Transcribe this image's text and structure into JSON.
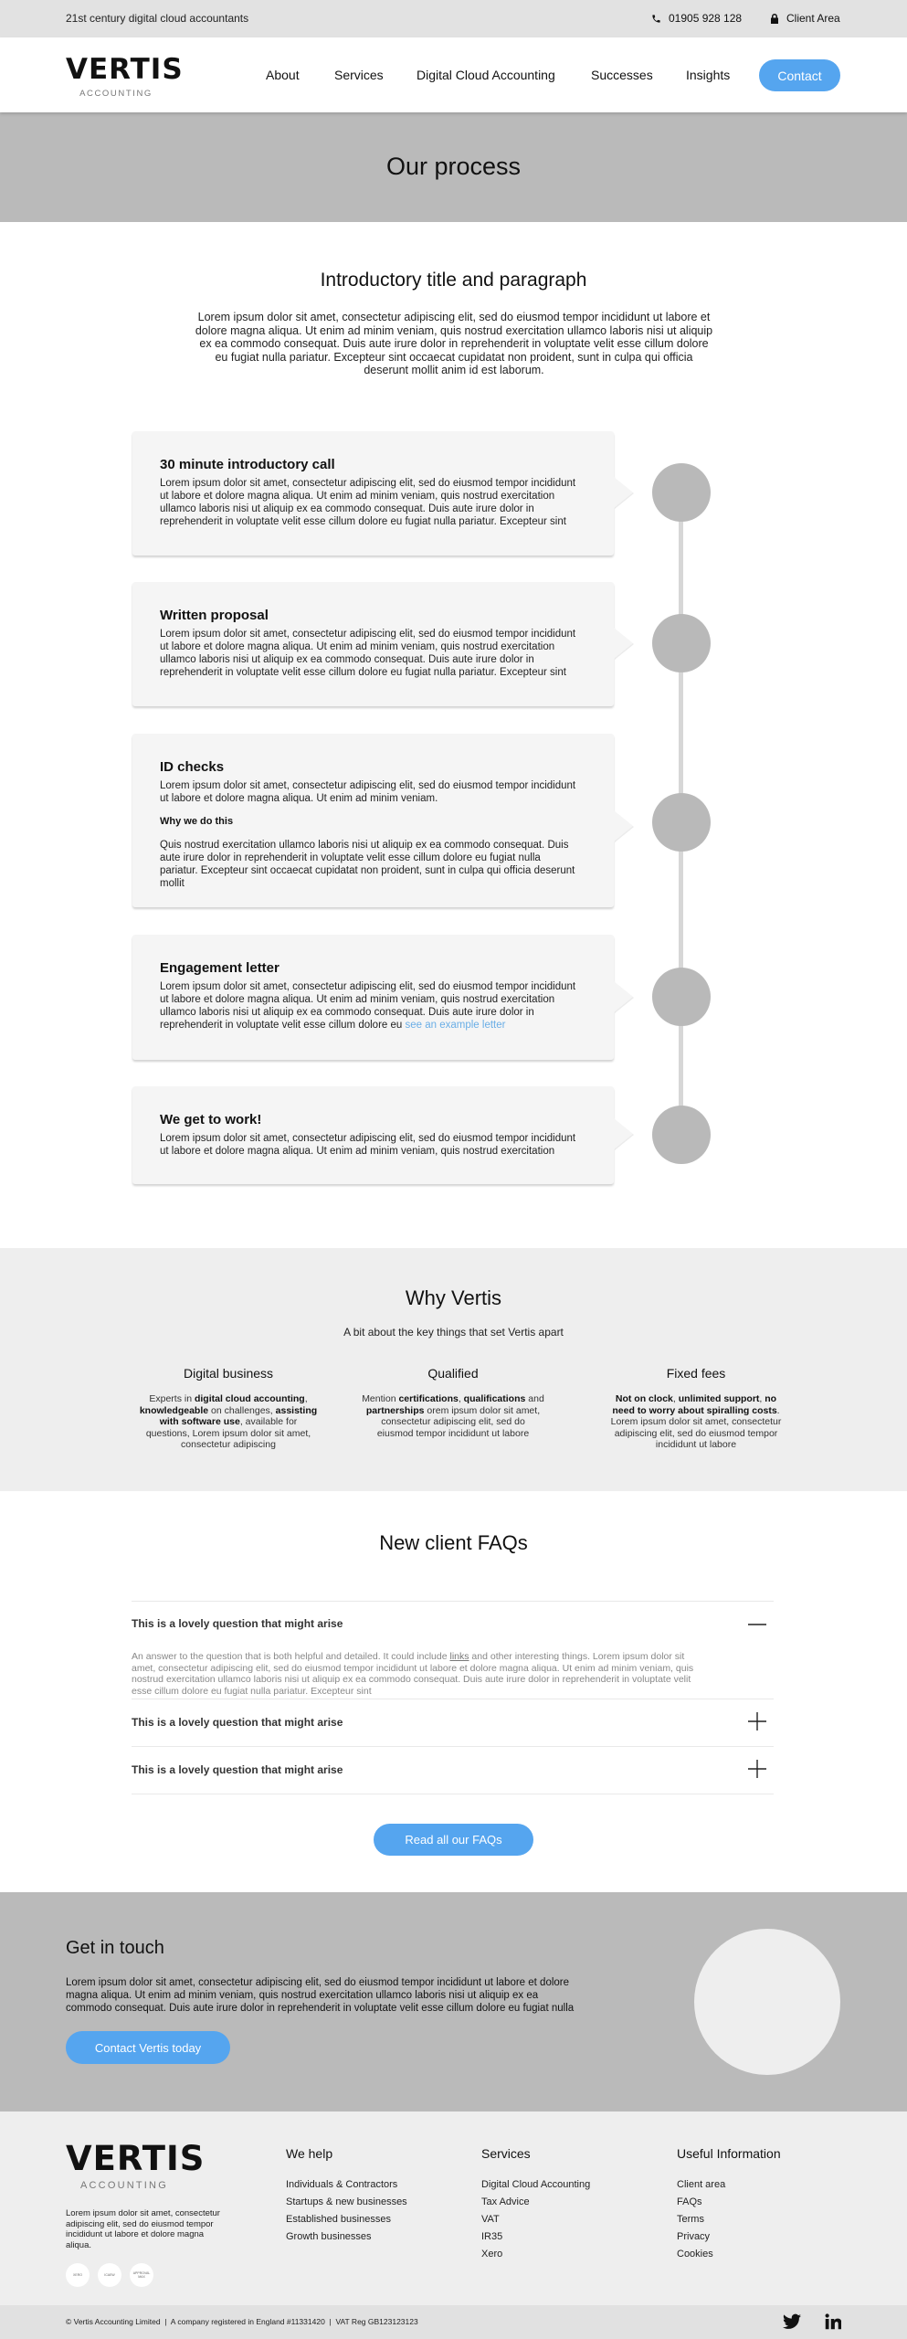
{
  "topbar": {
    "tagline": "21st century digital cloud accountants",
    "phone": "01905 928 128",
    "client_area": "Client Area"
  },
  "brand": {
    "name": "VERTIS",
    "subtitle": "ACCOUNTING"
  },
  "nav": {
    "items": [
      "About",
      "Services",
      "Digital Cloud Accounting",
      "Successes",
      "Insights"
    ],
    "cta": "Contact"
  },
  "hero": {
    "title": "Our process"
  },
  "intro": {
    "title": "Introductory title and paragraph",
    "text": "Lorem ipsum dolor sit amet, consectetur adipiscing elit, sed do eiusmod tempor incididunt ut labore et dolore magna aliqua. Ut enim ad minim veniam, quis nostrud exercitation ullamco laboris nisi ut aliquip ex ea commodo consequat. Duis aute irure dolor in reprehenderit in voluptate velit esse cillum dolore eu fugiat nulla pariatur. Excepteur sint occaecat cupidatat non proident, sunt in culpa qui officia deserunt mollit anim id est laborum."
  },
  "steps": [
    {
      "title": "30 minute introductory call",
      "text": "Lorem ipsum dolor sit amet, consectetur adipiscing elit, sed do eiusmod tempor incididunt ut labore et dolore magna aliqua. Ut enim ad minim veniam, quis nostrud exercitation ullamco laboris nisi ut aliquip ex ea commodo consequat. Duis aute irure dolor in reprehenderit in voluptate velit esse cillum dolore eu fugiat nulla pariatur. Excepteur sint"
    },
    {
      "title": "Written proposal",
      "text": "Lorem ipsum dolor sit amet, consectetur adipiscing elit, sed do eiusmod tempor incididunt ut labore et dolore magna aliqua. Ut enim ad minim veniam, quis nostrud exercitation ullamco laboris nisi ut aliquip ex ea commodo consequat. Duis aute irure dolor in reprehenderit in voluptate velit esse cillum dolore eu fugiat nulla pariatur. Excepteur sint"
    },
    {
      "title": "ID checks",
      "text": "Lorem ipsum dolor sit amet, consectetur adipiscing elit, sed do eiusmod tempor incididunt ut labore et dolore magna aliqua. Ut enim ad minim veniam.",
      "subheading": "Why we do this",
      "subtext": "Quis nostrud exercitation ullamco laboris nisi ut aliquip ex ea commodo consequat. Duis aute irure dolor in reprehenderit in voluptate velit esse cillum dolore eu fugiat nulla pariatur. Excepteur sint occaecat cupidatat non proident, sunt in culpa qui officia deserunt mollit"
    },
    {
      "title": "Engagement letter",
      "text": "Lorem ipsum dolor sit amet, consectetur adipiscing elit, sed do eiusmod tempor incididunt ut labore et dolore magna aliqua. Ut enim ad minim veniam, quis nostrud exercitation ullamco laboris nisi ut aliquip ex ea commodo consequat. Duis aute irure dolor in reprehenderit in voluptate velit esse cillum dolore eu",
      "link": "see an example letter"
    },
    {
      "title": "We get to work!",
      "text": "Lorem ipsum dolor sit amet, consectetur adipiscing elit, sed do eiusmod tempor incididunt ut labore et dolore magna aliqua. Ut enim ad minim veniam, quis nostrud exercitation"
    }
  ],
  "why": {
    "title": "Why Vertis",
    "subtitle": "A bit about the key things that set Vertis apart",
    "columns": [
      {
        "title": "Digital business",
        "parts": [
          {
            "t": "Experts in ",
            "b": false
          },
          {
            "t": "digital cloud accounting",
            "b": true
          },
          {
            "t": ", ",
            "b": false
          },
          {
            "t": "knowledgeable",
            "b": true
          },
          {
            "t": " on challenges, ",
            "b": false
          },
          {
            "t": "assisting with software use",
            "b": true
          },
          {
            "t": ", available for questions, Lorem ipsum dolor sit amet, consectetur adipiscing",
            "b": false
          }
        ]
      },
      {
        "title": "Qualified",
        "parts": [
          {
            "t": "Mention ",
            "b": false
          },
          {
            "t": "certifications",
            "b": true
          },
          {
            "t": ", ",
            "b": false
          },
          {
            "t": "qualifications",
            "b": true
          },
          {
            "t": " and ",
            "b": false
          },
          {
            "t": "partnerships",
            "b": true
          },
          {
            "t": " orem ipsum dolor sit amet, consectetur adipiscing elit, sed do eiusmod tempor incididunt ut labore",
            "b": false
          }
        ]
      },
      {
        "title": "Fixed fees",
        "parts": [
          {
            "t": "Not on clock",
            "b": true
          },
          {
            "t": ", ",
            "b": false
          },
          {
            "t": "unlimited support",
            "b": true
          },
          {
            "t": ", ",
            "b": false
          },
          {
            "t": "no need to worry about spiralling costs",
            "b": true
          },
          {
            "t": ". Lorem ipsum dolor sit amet, consectetur adipiscing elit, sed do eiusmod tempor incididunt ut labore",
            "b": false
          }
        ]
      }
    ]
  },
  "faq": {
    "title": "New client FAQs",
    "items": [
      {
        "question": "This is a lovely question that might arise",
        "expanded": true,
        "answer_before": "An answer to the question that is both helpful and detailed. It could include ",
        "answer_link": "links",
        "answer_after": " and other interesting things. Lorem ipsum dolor sit amet, consectetur adipiscing elit, sed do eiusmod tempor incididunt ut labore et dolore magna aliqua. Ut enim ad minim veniam, quis nostrud exercitation ullamco laboris nisi ut aliquip ex ea commodo consequat. Duis aute irure dolor in reprehenderit in voluptate velit esse cillum dolore eu fugiat nulla pariatur. Excepteur sint"
      },
      {
        "question": "This is a lovely question that might arise",
        "expanded": false
      },
      {
        "question": "This is a lovely question that might arise",
        "expanded": false
      }
    ],
    "button": "Read all our FAQs"
  },
  "cta": {
    "title": "Get in touch",
    "text": "Lorem ipsum dolor sit amet, consectetur adipiscing elit, sed do eiusmod tempor incididunt ut labore et dolore magna aliqua. Ut enim ad minim veniam, quis nostrud exercitation ullamco laboris nisi ut aliquip ex ea commodo consequat. Duis aute irure dolor in reprehenderit in voluptate velit esse cillum dolore eu fugiat nulla",
    "button": "Contact Vertis today"
  },
  "footer": {
    "about": "Lorem ipsum dolor sit amet, consectetur adipiscing elit, sed do eiusmod tempor incididunt ut labore et dolore magna aliqua.",
    "badges": [
      "XERO",
      "ICAEW",
      "APPROVAL MAX"
    ],
    "columns": [
      {
        "title": "We help",
        "links": [
          "Individuals & Contractors",
          "Startups & new businesses",
          "Established businesses",
          "Growth businesses"
        ]
      },
      {
        "title": "Services",
        "links": [
          "Digital Cloud Accounting",
          "Tax Advice",
          "VAT",
          "IR35",
          "Xero"
        ]
      },
      {
        "title": "Useful Information",
        "links": [
          "Client area",
          "FAQs",
          "Terms",
          "Privacy",
          "Cookies"
        ]
      }
    ],
    "legal": "© Vertis Accounting Limited  |  A company registered in England #11331420  |  VAT Reg GB123123123",
    "social": [
      "twitter-icon",
      "linkedin-icon"
    ]
  },
  "colors": {
    "accent": "#55a5ef",
    "link": "#6aaee6",
    "hero_bg": "#bababa",
    "section_bg": "#eeeeee"
  }
}
